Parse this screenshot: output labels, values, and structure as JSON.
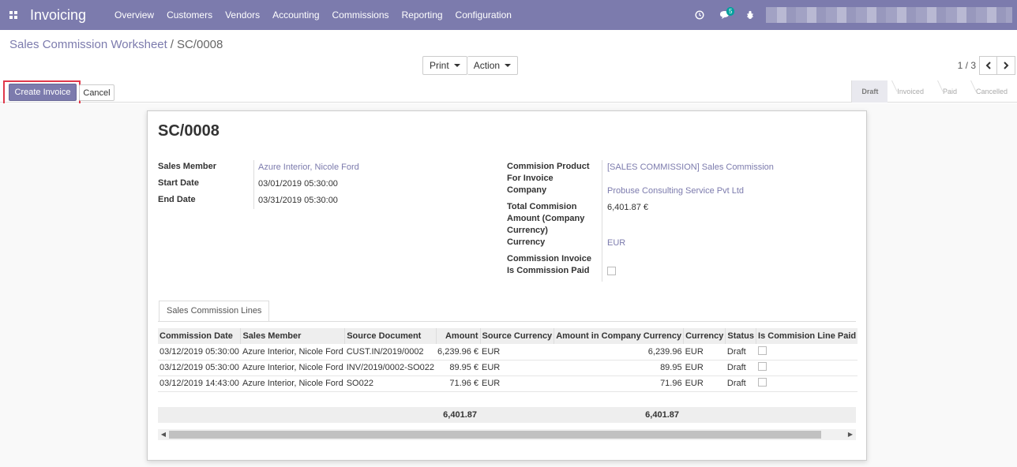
{
  "navbar": {
    "app_title": "Invoicing",
    "menu": [
      "Overview",
      "Customers",
      "Vendors",
      "Accounting",
      "Commissions",
      "Reporting",
      "Configuration"
    ],
    "messages_badge": "5",
    "bg_color": "#7C7BAD"
  },
  "breadcrumb": {
    "parent": "Sales Commission Worksheet",
    "current": "SC/0008"
  },
  "toolbar": {
    "print_label": "Print",
    "action_label": "Action"
  },
  "pager": {
    "value": "1 / 3"
  },
  "statusbar": {
    "create_invoice_label": "Create Invoice",
    "cancel_label": "Cancel",
    "stages": [
      "Draft",
      "Invoiced",
      "Paid",
      "Cancelled"
    ],
    "active_stage": "Draft"
  },
  "form": {
    "title": "SC/0008",
    "left": {
      "sales_member_label": "Sales Member",
      "sales_member": "Azure Interior, Nicole Ford",
      "start_date_label": "Start Date",
      "start_date": "03/01/2019 05:30:00",
      "end_date_label": "End Date",
      "end_date": "03/31/2019 05:30:00"
    },
    "right": {
      "product_label_1": "Commision Product",
      "product_label_2": "For Invoice",
      "product": "[SALES COMMISSION] Sales Commission",
      "company_label": "Company",
      "company": "Probuse Consulting Service Pvt Ltd",
      "total_label_1": "Total Commision",
      "total_label_2": "Amount (Company",
      "total_label_3": "Currency)",
      "total": "6,401.87 €",
      "currency_label": "Currency",
      "currency": "EUR",
      "commission_invoice_label": "Commission Invoice",
      "is_paid_label": "Is Commission Paid"
    }
  },
  "tab": {
    "label": "Sales Commission Lines"
  },
  "lines": {
    "headers": [
      "Commission Date",
      "Sales Member",
      "Source Document",
      "Amount",
      "Source Currency",
      "Amount in Company Currency",
      "Currency",
      "Status",
      "Is Commision Line Paid"
    ],
    "rows": [
      [
        "03/12/2019 05:30:00",
        "Azure Interior, Nicole Ford",
        "CUST.IN/2019/0002",
        "6,239.96 €",
        "EUR",
        "6,239.96",
        "EUR",
        "Draft"
      ],
      [
        "03/12/2019 05:30:00",
        "Azure Interior, Nicole Ford",
        "INV/2019/0002-SO022",
        "89.95 €",
        "EUR",
        "89.95",
        "EUR",
        "Draft"
      ],
      [
        "03/12/2019 14:43:00",
        "Azure Interior, Nicole Ford",
        "SO022",
        "71.96 €",
        "EUR",
        "71.96",
        "EUR",
        "Draft"
      ]
    ],
    "total_amount": "6,401.87",
    "total_company_amount": "6,401.87"
  }
}
